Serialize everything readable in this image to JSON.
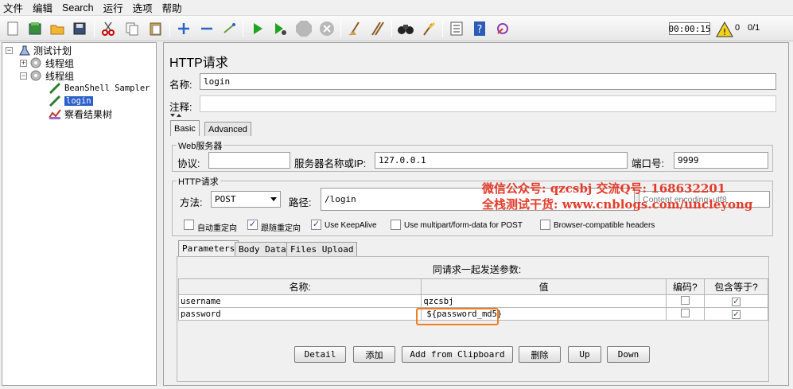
{
  "menu": [
    "文件",
    "编辑",
    "Search",
    "运行",
    "选项",
    "帮助"
  ],
  "toolbar": {
    "timer": "00:00:15",
    "warnings": "0",
    "threads": "0/1",
    "icons": [
      "new-icon",
      "templates-icon",
      "open-icon",
      "save-icon",
      "cut-icon",
      "copy-icon",
      "paste-icon",
      "expand-icon",
      "collapse-icon",
      "toggle-icon",
      "start-icon",
      "start-no-pause-icon",
      "stop-icon",
      "shutdown-icon",
      "clear-icon",
      "clear-all-icon",
      "search-icon",
      "reset-search-icon",
      "function-helper-icon",
      "help-icon",
      "remote-icon",
      "warning-icon"
    ]
  },
  "tree": {
    "items": [
      {
        "label": "测试计划"
      },
      {
        "label": "线程组"
      },
      {
        "label": "线程组"
      },
      {
        "label": "BeanShell Sampler"
      },
      {
        "label": "login"
      },
      {
        "label": "察看结果树"
      }
    ]
  },
  "panel": {
    "title": "HTTP请求",
    "name_label": "名称:",
    "name_value": "login",
    "comment_label": "注释:",
    "tabs": [
      "Basic",
      "Advanced"
    ],
    "web_server": {
      "title": "Web服务器",
      "protocol_label": "协议:",
      "server_label": "服务器名称或IP:",
      "server_value": "127.0.0.1",
      "port_label": "端口号:",
      "port_value": "9999"
    },
    "http_request": {
      "title": "HTTP请求",
      "method_label": "方法:",
      "method_value": "POST",
      "path_label": "路径:",
      "path_value": "/login",
      "encoding_placeholder": "Content encoding: utf8"
    },
    "options": [
      {
        "label": "自动重定向",
        "checked": false
      },
      {
        "label": "跟随重定向",
        "checked": true
      },
      {
        "label": "Use KeepAlive",
        "checked": true
      },
      {
        "label": "Use multipart/form-data for POST",
        "checked": false
      },
      {
        "label": "Browser-compatible headers",
        "checked": false
      }
    ],
    "subtabs": [
      "Parameters",
      "Body Data",
      "Files Upload"
    ],
    "params_caption": "同请求一起发送参数:",
    "columns": [
      "名称:",
      "值",
      "编码?",
      "包含等于?"
    ],
    "rows": [
      {
        "name": "username",
        "value": "qzcsbj",
        "encode": false,
        "include_equals": true
      },
      {
        "name": "password",
        "value": "${password_md5}",
        "encode": false,
        "include_equals": true
      }
    ],
    "buttons": [
      "Detail",
      "添加",
      "Add from Clipboard",
      "删除",
      "Up",
      "Down"
    ]
  },
  "watermark": {
    "line1": "微信公众号: qzcsbj   交流Q号: 168632201",
    "line2": "全栈测试干货: www.cnblogs.com/uncleyong"
  },
  "colors": {
    "selection": "#2b5fc9",
    "watermark": "#e33b2a",
    "highlight": "#f07d1e"
  }
}
